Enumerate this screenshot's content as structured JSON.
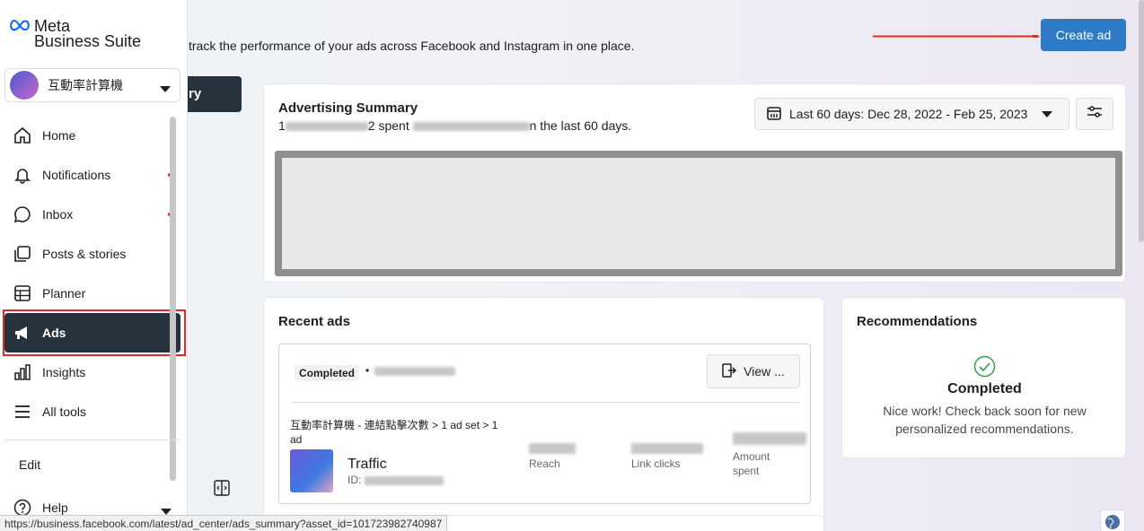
{
  "logo": {
    "line1": "Meta",
    "line2": "Business Suite"
  },
  "account": {
    "name": "互動率計算機"
  },
  "nav": {
    "items": [
      {
        "label": "Home"
      },
      {
        "label": "Notifications"
      },
      {
        "label": "Inbox"
      },
      {
        "label": "Posts & stories"
      },
      {
        "label": "Planner"
      },
      {
        "label": "Ads"
      },
      {
        "label": "Insights"
      },
      {
        "label": "All tools"
      }
    ],
    "edit": "Edit",
    "help": "Help"
  },
  "header": {
    "intro": "track the performance of your ads across Facebook and Instagram in one place.",
    "dark_tab_fragment": "ry",
    "create_ad": "Create ad"
  },
  "summary": {
    "title": "Advertising Summary",
    "sub_prefix": "1",
    "sub_mid": "2 spent",
    "sub_suffix": "n the last 60 days.",
    "date_range": "Last 60 days: Dec 28, 2022 - Feb 25, 2023"
  },
  "recent": {
    "title": "Recent ads",
    "status": "Completed",
    "view_button": "View ...",
    "path": "互動率計算機 - 連結點擊次數 > 1 ad set > 1 ad",
    "ad_name": "Traffic",
    "id_label": "ID:",
    "metrics": {
      "reach": "Reach",
      "link_clicks": "Link clicks",
      "amount_spent": "Amount spent"
    }
  },
  "recommendations": {
    "title": "Recommendations",
    "status": "Completed",
    "message": "Nice work! Check back soon for new personalized recommendations."
  },
  "status_bar": {
    "url": "https://business.facebook.com/latest/ad_center/ads_summary?asset_id=101723982740987"
  },
  "colors": {
    "primary_button": "#2d7bc6",
    "active_nav": "#26323c",
    "annotation_red": "#e02b20",
    "success_green": "#31a24c"
  }
}
